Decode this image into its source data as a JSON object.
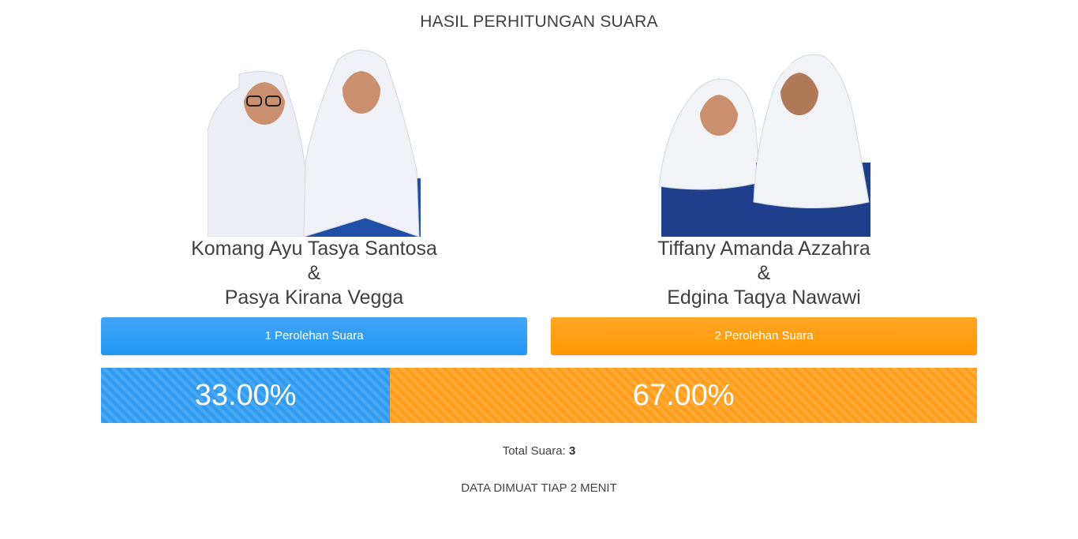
{
  "header": {
    "title": "HASIL PERHITUNGAN SUARA"
  },
  "candidates": [
    {
      "number_label": "1 Perolehan Suara",
      "name_1": "Komang Ayu Tasya Santosa",
      "separator": "&",
      "name_2": "Pasya Kirana Vegga",
      "percent_label": "33.00%",
      "percent": 33.0,
      "color": "#2196f3"
    },
    {
      "number_label": "2 Perolehan Suara",
      "name_1": "Tiffany Amanda Azzahra",
      "separator": "&",
      "name_2": "Edgina Taqya Nawawi",
      "percent_label": "67.00%",
      "percent": 67.0,
      "color": "#ff9800"
    }
  ],
  "footer": {
    "total_label": "Total Suara:",
    "total_value": "3",
    "refresh_note": "DATA DIMUAT TIAP 2 MENIT"
  }
}
